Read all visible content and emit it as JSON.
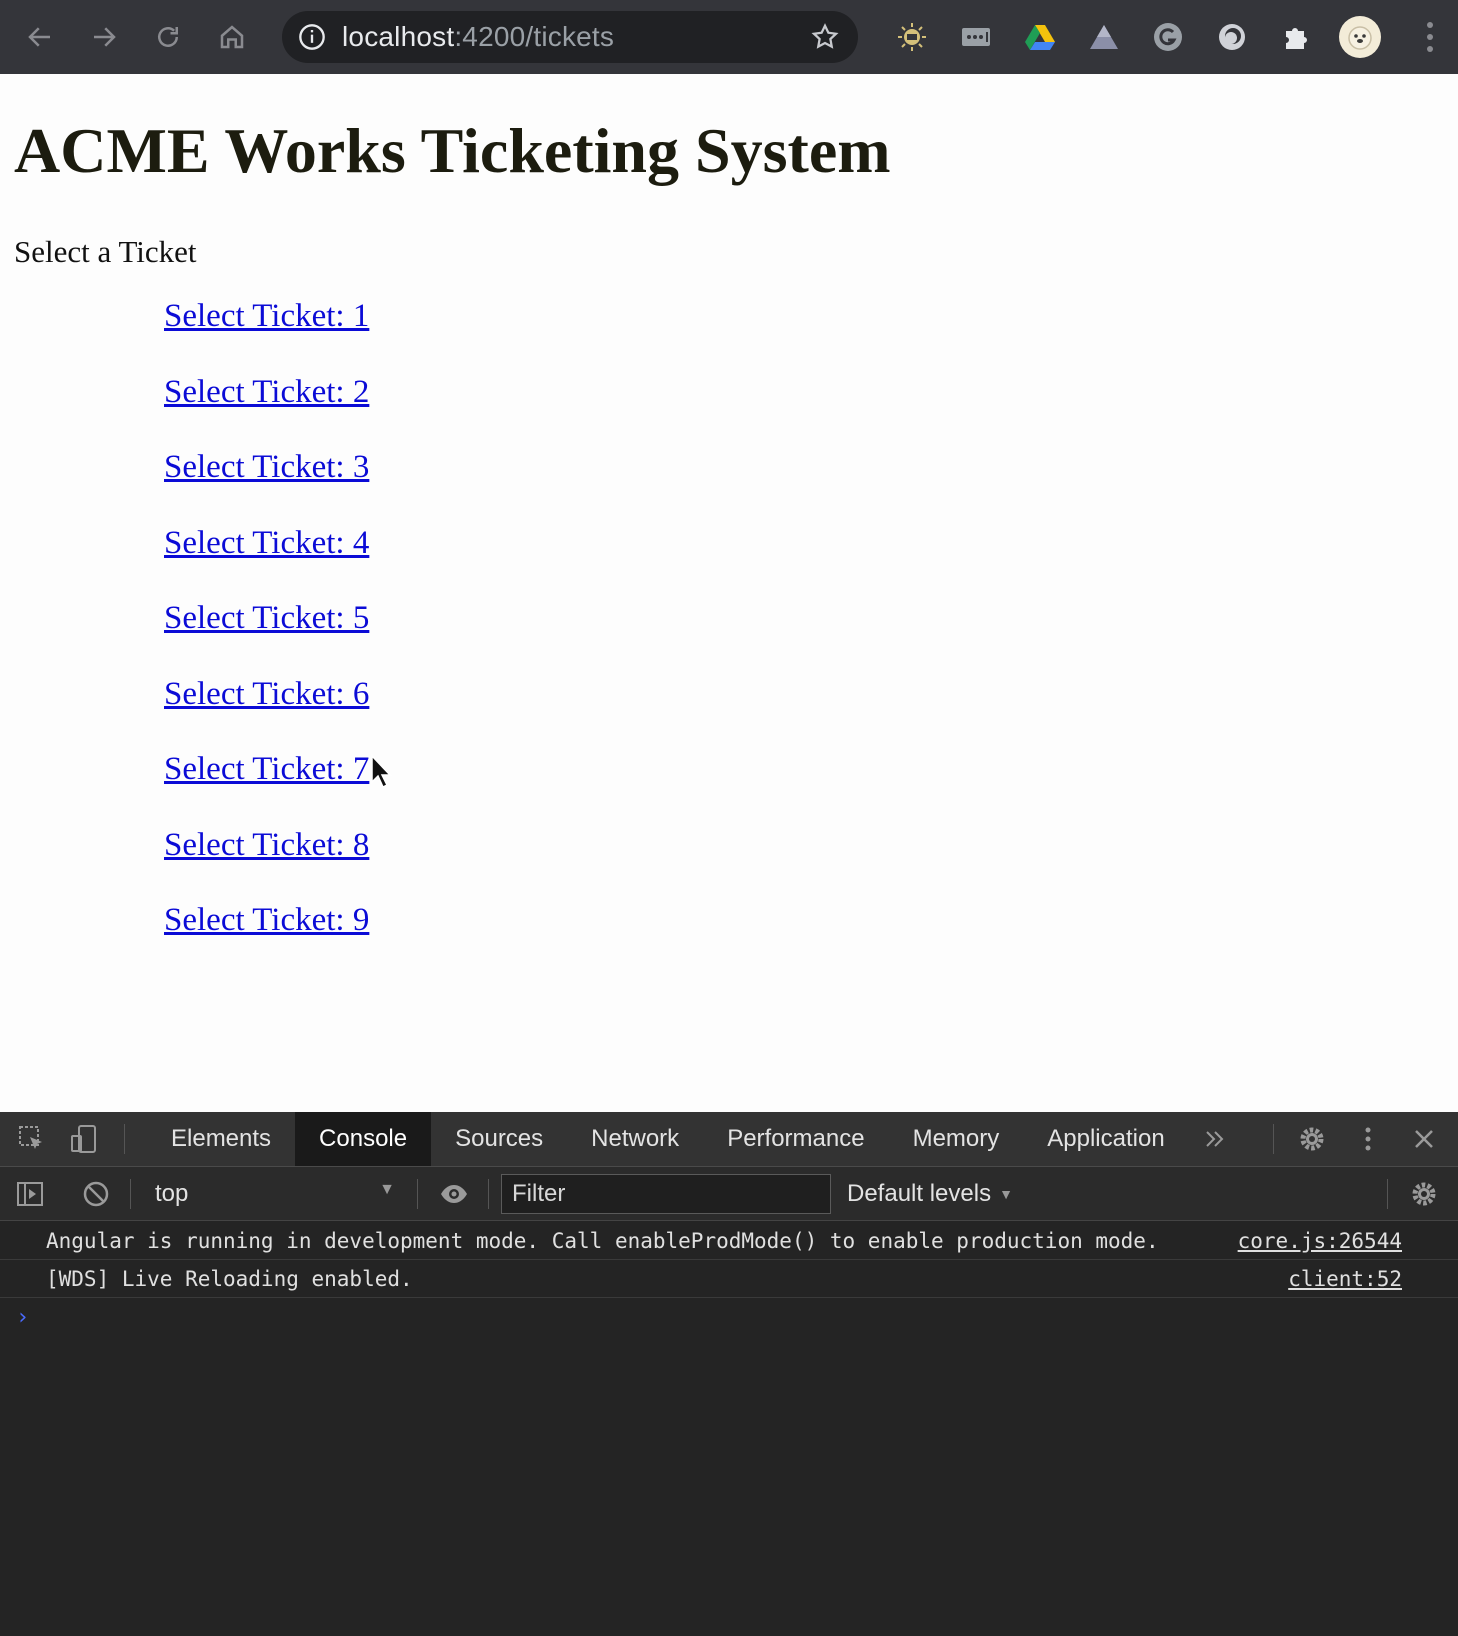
{
  "browser": {
    "url_host": "localhost",
    "url_path": ":4200/tickets",
    "icons": [
      "back-icon",
      "forward-icon",
      "reload-icon",
      "home-icon",
      "site-info-icon",
      "bookmark-star-icon",
      "extension-sun-icon",
      "extension-dots-icon",
      "drive-icon",
      "drive-alt-icon",
      "grammarly-icon",
      "extension-circle-icon",
      "extensions-puzzle-icon",
      "profile-avatar",
      "menu-icon"
    ]
  },
  "page": {
    "title": "ACME Works Ticketing System",
    "subtitle": "Select a Ticket",
    "tickets": [
      "Select Ticket: 1",
      "Select Ticket: 2",
      "Select Ticket: 3",
      "Select Ticket: 4",
      "Select Ticket: 5",
      "Select Ticket: 6",
      "Select Ticket: 7",
      "Select Ticket: 8",
      "Select Ticket: 9"
    ],
    "link_color": "#0b0bd6"
  },
  "devtools": {
    "tabs": [
      "Elements",
      "Console",
      "Sources",
      "Network",
      "Performance",
      "Memory",
      "Application"
    ],
    "active_tab": "Console",
    "context": "top",
    "filter_placeholder": "Filter",
    "levels": "Default levels",
    "messages": [
      {
        "text": "Angular is running in development mode. Call enableProdMode() to enable production mode.",
        "source": "core.js:26544"
      },
      {
        "text": "[WDS] Live Reloading enabled.",
        "source": "client:52"
      }
    ],
    "prompt": "›"
  }
}
